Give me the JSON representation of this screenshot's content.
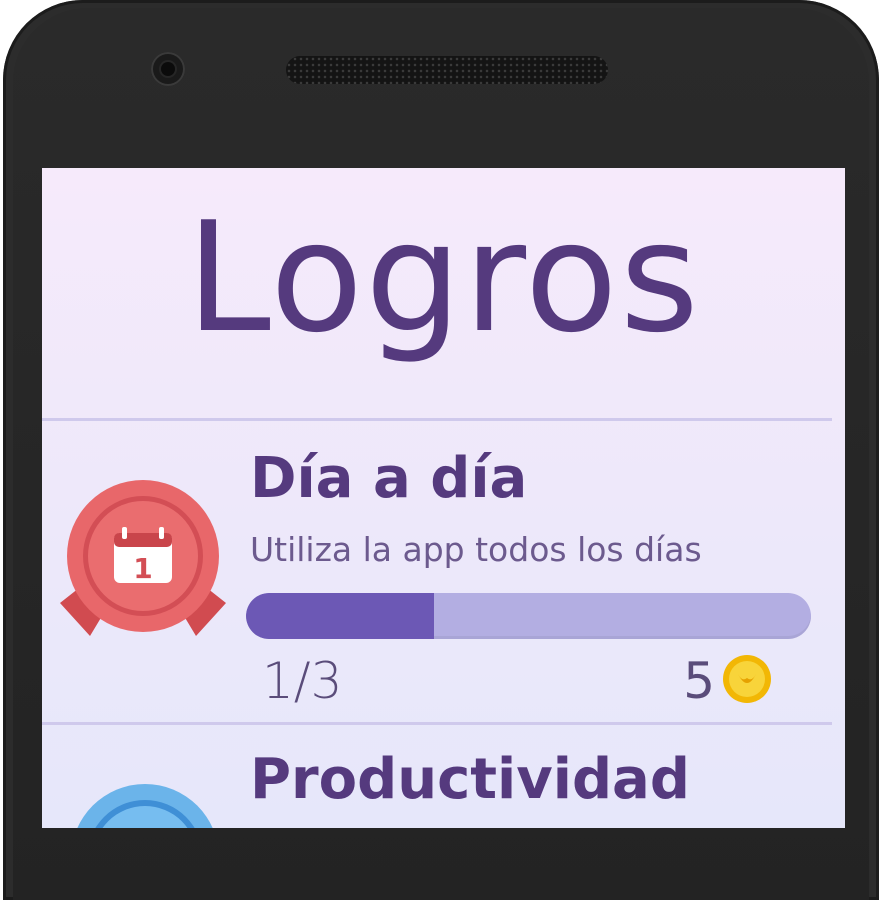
{
  "screen": {
    "title": "Logros"
  },
  "achievements": [
    {
      "name": "Día a día",
      "description": "Utiliza la app todos los días",
      "progress_text": "1/3",
      "progress_fraction": 0.333,
      "reward": "5",
      "badge_icon": "calendar-icon",
      "badge_number": "1",
      "badge_color": "#e8676a"
    },
    {
      "name": "Productividad",
      "badge_color": "#6bb4ea"
    }
  ],
  "colors": {
    "title": "#553a7e",
    "progress_fill": "#6c58b5",
    "progress_track": "#b3aee2",
    "coin": "#f5c518"
  }
}
